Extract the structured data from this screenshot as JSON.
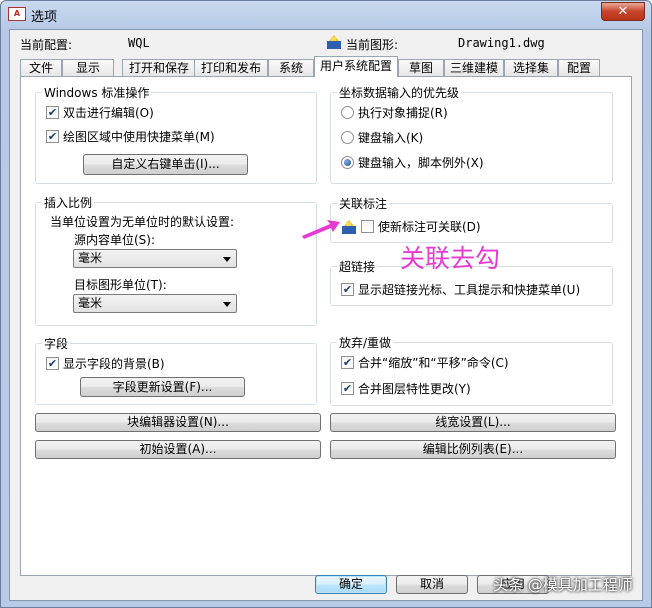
{
  "window": {
    "title": "选项",
    "close_symbol": "✕",
    "app_badge": "A"
  },
  "config": {
    "current_profile_label": "当前配置:",
    "current_profile_value": "WQL",
    "current_drawing_label": "当前图形:",
    "current_drawing_value": "Drawing1.dwg"
  },
  "tabs": [
    "文件",
    "显示",
    "打开和保存",
    "打印和发布",
    "系统",
    "用户系统配置",
    "草图",
    "三维建模",
    "选择集",
    "配置"
  ],
  "active_tab_index": 5,
  "windows_ops": {
    "legend": "Windows 标准操作",
    "dblclick_edit": "双击进行编辑(O)",
    "shortcut_menu": "绘图区域中使用快捷菜单(M)",
    "custom_right_click": "自定义右键单击(I)..."
  },
  "insert_scale": {
    "legend": "插入比例",
    "note": "当单位设置为无单位时的默认设置:",
    "source_label": "源内容单位(S):",
    "source_value": "毫米",
    "target_label": "目标图形单位(T):",
    "target_value": "毫米"
  },
  "fields": {
    "legend": "字段",
    "show_bg": "显示字段的背景(B)",
    "update_settings": "字段更新设置(F)..."
  },
  "coord_priority": {
    "legend": "坐标数据输入的优先级",
    "options": [
      "执行对象捕捉(R)",
      "键盘输入(K)",
      "键盘输入，脚本例外(X)"
    ],
    "selected_index": 2
  },
  "assoc_dim": {
    "legend": "关联标注",
    "make_assoc": "使新标注可关联(D)"
  },
  "hyperlink": {
    "legend": "超链接",
    "show_cursor": "显示超链接光标、工具提示和快捷菜单(U)"
  },
  "undo_redo": {
    "legend": "放弃/重做",
    "merge_zoom_pan": "合并“缩放”和“平移”命令(C)",
    "merge_layer": "合并图层特性更改(Y)"
  },
  "buttons": {
    "block_editor": "块编辑器设置(N)...",
    "lineweight": "线宽设置(L)...",
    "initial_setup": "初始设置(A)...",
    "scale_list": "编辑比例列表(E)...",
    "ok": "确定",
    "cancel": "取消",
    "apply": "应用"
  },
  "annotation": {
    "text": "关联去勾",
    "color": "#e63ad2"
  },
  "watermark": "头条 @模具加工程师"
}
